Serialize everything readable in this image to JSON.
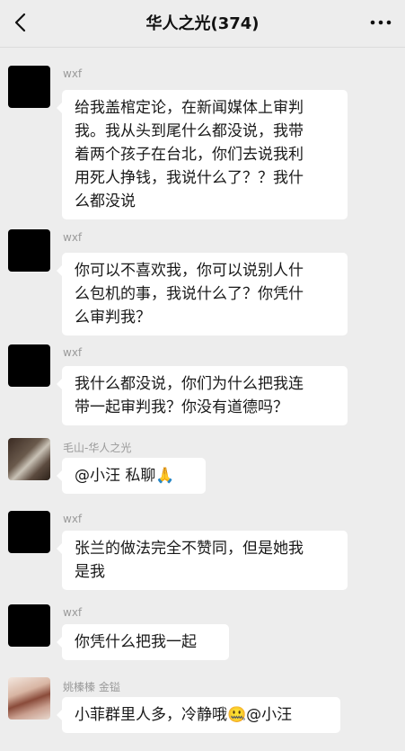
{
  "header": {
    "title": "华人之光(374)",
    "back_icon": "chevron-left-icon",
    "more_icon": "more-dots-icon"
  },
  "messages": [
    {
      "sender": "wxf",
      "avatar": "black",
      "lines": [
        "给我盖棺定论，在新闻媒体上审判",
        "我。我从头到尾什么都没说，我带",
        "着两个孩子在台北，你们去说我利",
        "用死人挣钱，我说什么了？？我什",
        "么都没说"
      ]
    },
    {
      "sender": "wxf",
      "avatar": "black",
      "lines": [
        "你可以不喜欢我，你可以说别人什",
        "么包机的事，我说什么了？你凭什",
        "么审判我？"
      ]
    },
    {
      "sender": "wxf",
      "avatar": "black",
      "lines": [
        "我什么都没说，你们为什么把我连",
        "带一起审判我？你没有道德吗？"
      ]
    },
    {
      "sender": "毛山-华人之光",
      "avatar": "photo1",
      "lines": [
        "@小汪  私聊🙏"
      ]
    },
    {
      "sender": "wxf",
      "avatar": "black",
      "lines": [
        "张兰的做法完全不赞同，但是她我",
        "是我"
      ]
    },
    {
      "sender": "wxf",
      "avatar": "black",
      "lines": [
        "你凭什么把我一起"
      ]
    },
    {
      "sender": "姚榛榛 金镒",
      "avatar": "photo2",
      "lines": [
        "小菲群里人多，冷静哦🤐@小汪"
      ]
    }
  ]
}
